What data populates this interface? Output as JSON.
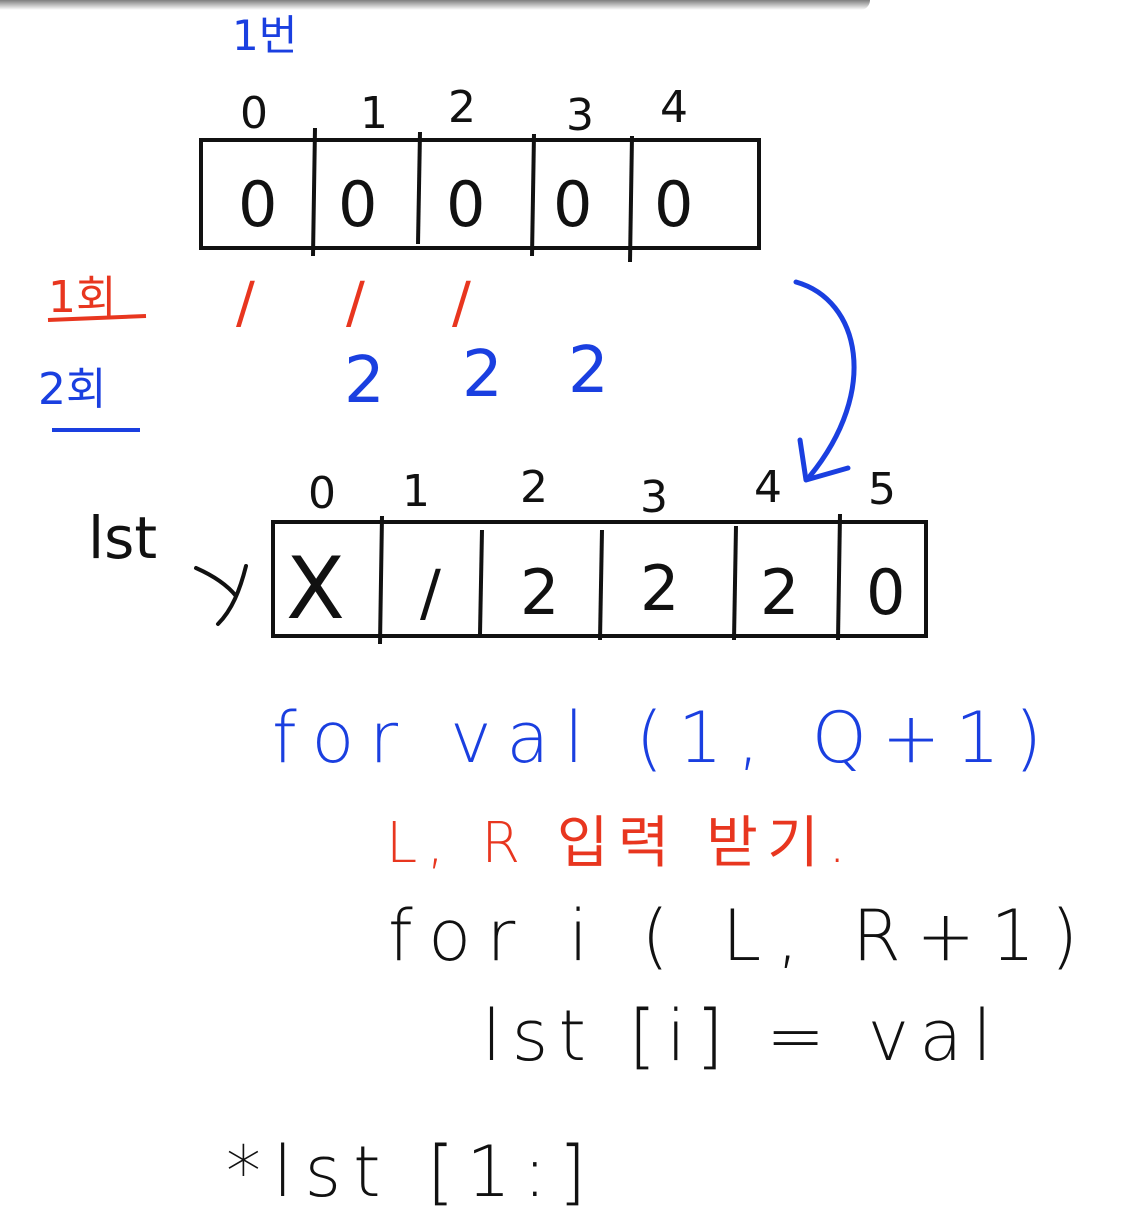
{
  "colors": {
    "ink": "#111111",
    "red": "#e8361f",
    "blue": "#1a3fe0"
  },
  "title": "1번",
  "array1": {
    "indices": [
      "0",
      "1",
      "2",
      "3",
      "4"
    ],
    "cells": [
      "0",
      "0",
      "0",
      "0",
      "0"
    ]
  },
  "round_labels": {
    "r1": "1회",
    "r2": "2회"
  },
  "round1_marks": [
    "/",
    "/",
    "/"
  ],
  "round2_marks": [
    "2",
    "2",
    "2"
  ],
  "array2": {
    "name": "lst",
    "indices": [
      "0",
      "1",
      "2",
      "3",
      "4",
      "5"
    ],
    "cells": [
      "X",
      "/",
      "2",
      "2",
      "2",
      "0"
    ]
  },
  "code": {
    "line1": "for val (1, Q+1)",
    "line2": "L, R 입력 받기.",
    "line3": "for i ( L, R+1)",
    "line4": "lst [i] = val",
    "line5": "*lst [1:]"
  }
}
